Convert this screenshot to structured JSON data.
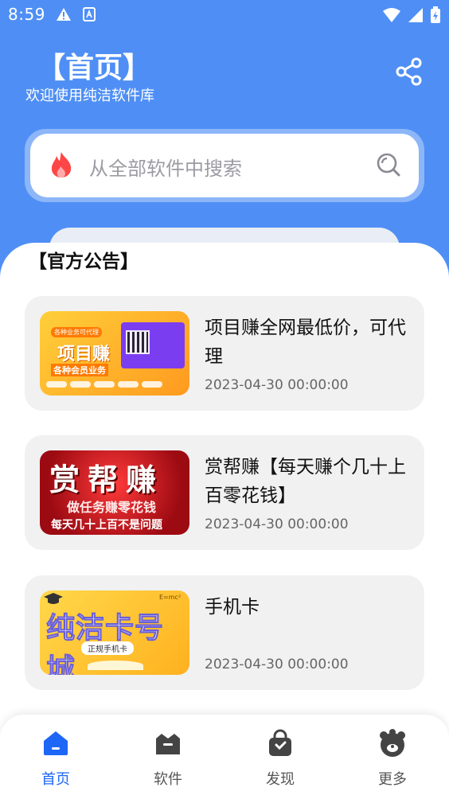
{
  "status_bar": {
    "time": "8:59",
    "icons": [
      "warning-icon",
      "keyboard-a-icon",
      "wifi-icon",
      "signal-icon",
      "battery-charging-icon"
    ]
  },
  "header": {
    "title": "【首页】",
    "subtitle": "欢迎使用纯洁软件库",
    "share_icon": "share-icon"
  },
  "search": {
    "placeholder": "从全部软件中搜索",
    "left_icon": "flame-icon",
    "right_icon": "search-icon"
  },
  "announcements": {
    "title": "【官方公告】",
    "items": [
      {
        "title": "项目赚全网最低价，可代理",
        "date": "2023-04-30 00:00:00",
        "thumb": {
          "top": "各种业务可代理",
          "big": "项目赚",
          "sub": "各种会员业务"
        }
      },
      {
        "title": "赏帮赚【每天赚个几十上百零花钱】",
        "date": "2023-04-30 00:00:00",
        "thumb": {
          "big": "赏帮赚",
          "mid": "做任务赚零花钱",
          "bot": "每天几十上百不是问题"
        }
      },
      {
        "title": "手机卡",
        "date": "2023-04-30 00:00:00",
        "thumb": {
          "big": "纯洁卡号城",
          "tag": "正规手机卡",
          "emc": "E=mc²"
        }
      }
    ]
  },
  "bottom_nav": {
    "active": "首页",
    "items": [
      {
        "label": "首页",
        "icon": "home-icon"
      },
      {
        "label": "软件",
        "icon": "software-box-icon"
      },
      {
        "label": "发现",
        "icon": "discover-bag-icon"
      },
      {
        "label": "更多",
        "icon": "more-bear-icon"
      }
    ]
  },
  "colors": {
    "primary": "#4f8ff5",
    "nav_active": "#1e66f5",
    "card_bg": "#f1f1f1"
  }
}
